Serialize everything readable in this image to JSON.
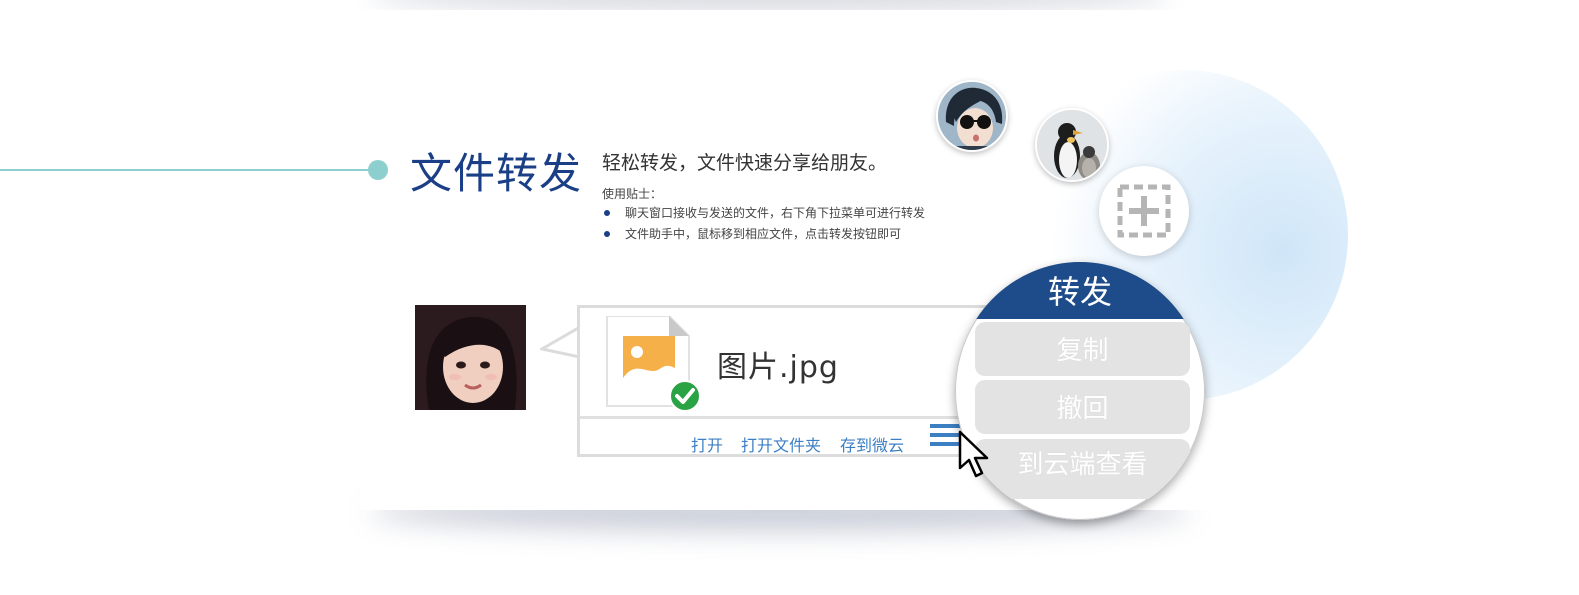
{
  "section": {
    "title": "文件转发",
    "tagline": "轻松转发，文件快速分享给朋友。",
    "tips_label": "使用贴士：",
    "tips": [
      "聊天窗口接收与发送的文件，右下角下拉菜单可进行转发",
      "文件助手中，鼠标移到相应文件，点击转发按钮即可"
    ]
  },
  "message": {
    "file_name": "图片.jpg",
    "actions": {
      "open": "打开",
      "open_folder": "打开文件夹",
      "save_to_weiyun": "存到微云"
    }
  },
  "context_menu": {
    "forward": "转发",
    "copy": "复制",
    "recall": "撤回",
    "view_in_cloud": "到云端查看"
  },
  "icons": {
    "file": "image-file-icon",
    "check": "check-circle-icon",
    "add": "add-contact-icon",
    "menu": "hamburger-menu-icon",
    "cursor": "mouse-pointer-icon"
  },
  "colors": {
    "title": "#1b3f86",
    "accent_teal": "#8ccfce",
    "link": "#3d7fc3",
    "menu_header": "#1e4b89",
    "check_green": "#2aa344",
    "file_orange": "#f5b04a"
  }
}
